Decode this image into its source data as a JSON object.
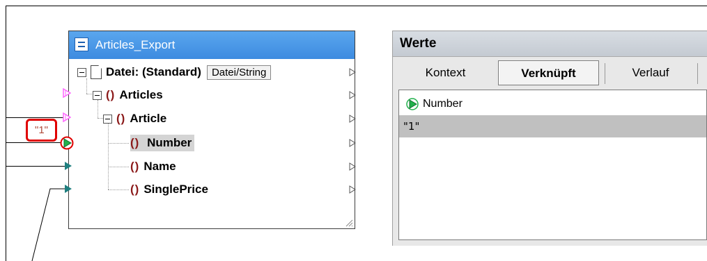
{
  "constant": {
    "value": "\"1\""
  },
  "component": {
    "title": "Articles_Export",
    "file_label": "Datei: (Standard)",
    "file_button": "Datei/String",
    "brace_glyph": "()",
    "nodes": {
      "articles": "Articles",
      "article": "Article",
      "number": "Number",
      "name": "Name",
      "single_price": "SinglePrice"
    },
    "colors": {
      "header": "#3d8be0",
      "element_brace": "#8b1a1a",
      "input_port_pink": "#ff66ff",
      "input_port_teal": "#1e7f7f",
      "selected_port": "#22b14c",
      "constant_highlight": "#e00000"
    }
  },
  "values_panel": {
    "title": "Werte",
    "tabs": [
      {
        "label": "Kontext",
        "active": false
      },
      {
        "label": "Verknüpft",
        "active": true
      },
      {
        "label": "Verlauf",
        "active": false
      }
    ],
    "list": {
      "header_label": "Number",
      "header_icon": "green-play-port-icon",
      "value": "\"1\""
    }
  }
}
